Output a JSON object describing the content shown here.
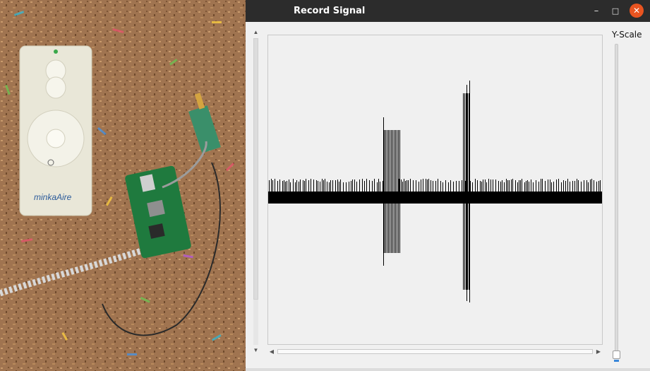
{
  "window": {
    "title": "Record Signal",
    "controls": {
      "minimize": "–",
      "maximize": "□",
      "close": "✕"
    }
  },
  "scrollbars": {
    "up_arrow": "▲",
    "down_arrow": "▼",
    "left_arrow": "◀",
    "right_arrow": "▶"
  },
  "y_scale": {
    "label": "Y-Scale",
    "level": 0.0
  },
  "photo": {
    "description_icons": [
      "remote-control",
      "raspberry-pi-board",
      "sdr-antenna-board",
      "usb-cable"
    ],
    "remote_logo": "minkaAire"
  },
  "colors": {
    "titlebar": "#2c2c2c",
    "close_button": "#e95420",
    "signal": "#000000",
    "background": "#f0f0f0",
    "slider_accent": "#3a87d9"
  }
}
